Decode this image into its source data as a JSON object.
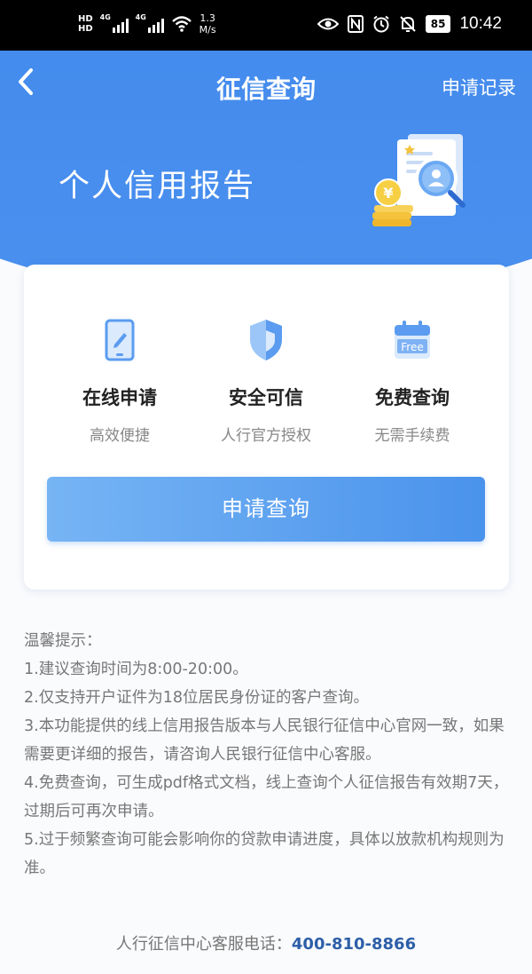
{
  "status_bar": {
    "hd1": "HD",
    "hd2": "HD",
    "net1": "4G",
    "net2": "4G",
    "speed_value": "1.3",
    "speed_unit": "M/s",
    "battery": "85",
    "time": "10:42"
  },
  "header": {
    "back_icon": "chevron-left-icon",
    "title": "征信查询",
    "records_link": "申请记录",
    "banner_title": "个人信用报告",
    "accent": "#3d86ec"
  },
  "features": [
    {
      "icon": "tablet-pen-icon",
      "title": "在线申请",
      "subtitle": "高效便捷"
    },
    {
      "icon": "shield-icon",
      "title": "安全可信",
      "subtitle": "人行官方授权"
    },
    {
      "icon": "free-calendar-icon",
      "icon_text": "Free",
      "title": "免费查询",
      "subtitle": "无需手续费"
    }
  ],
  "apply_button": "申请查询",
  "notes": {
    "title": "温馨提示：",
    "items": [
      "1.建议查询时间为8:00-20:00。",
      "2.仅支持开户证件为18位居民身份证的客户查询。",
      "3.本功能提供的线上信用报告版本与人民银行征信中心官网一致，如果需要更详细的报告，请咨询人民银行征信中心客服。",
      "4.免费查询，可生成pdf格式文档，线上查询个人征信报告有效期7天，过期后可再次申请。",
      "5.过于频繁查询可能会影响你的贷款申请进度，具体以放款机构规则为准。"
    ]
  },
  "footer": {
    "label": "人行征信中心客服电话：",
    "phone": "400-810-8866"
  }
}
